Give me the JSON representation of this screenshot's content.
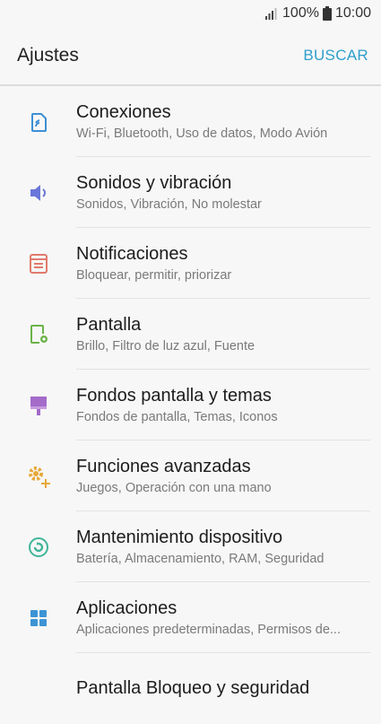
{
  "status": {
    "battery": "100%",
    "time": "10:00"
  },
  "header": {
    "title": "Ajustes",
    "search_label": "BUSCAR"
  },
  "items": [
    {
      "icon": "connections-icon",
      "title": "Conexiones",
      "subtitle": "Wi-Fi, Bluetooth, Uso de datos, Modo Avión",
      "color": "#3d8fd4"
    },
    {
      "icon": "sound-icon",
      "title": "Sonidos y vibración",
      "subtitle": "Sonidos, Vibración, No molestar",
      "color": "#6a76d8"
    },
    {
      "icon": "notifications-icon",
      "title": "Notificaciones",
      "subtitle": "Bloquear, permitir, priorizar",
      "color": "#e07b6e"
    },
    {
      "icon": "display-icon",
      "title": "Pantalla",
      "subtitle": "Brillo, Filtro de luz azul, Fuente",
      "color": "#6bb34a"
    },
    {
      "icon": "wallpaper-icon",
      "title": "Fondos pantalla y temas",
      "subtitle": "Fondos de pantalla, Temas, Iconos",
      "color": "#a46bc9"
    },
    {
      "icon": "advanced-features-icon",
      "title": "Funciones avanzadas",
      "subtitle": "Juegos, Operación con una mano",
      "color": "#e6a93a"
    },
    {
      "icon": "device-maintenance-icon",
      "title": "Mantenimiento dispositivo",
      "subtitle": "Batería, Almacenamiento, RAM, Seguridad",
      "color": "#3fb59a"
    },
    {
      "icon": "apps-icon",
      "title": "Aplicaciones",
      "subtitle": "Aplicaciones predeterminadas, Permisos de...",
      "color": "#3d94d4"
    },
    {
      "icon": "lock-icon",
      "title": "Pantalla Bloqueo y seguridad",
      "subtitle": "",
      "color": "#3d94d4"
    }
  ]
}
